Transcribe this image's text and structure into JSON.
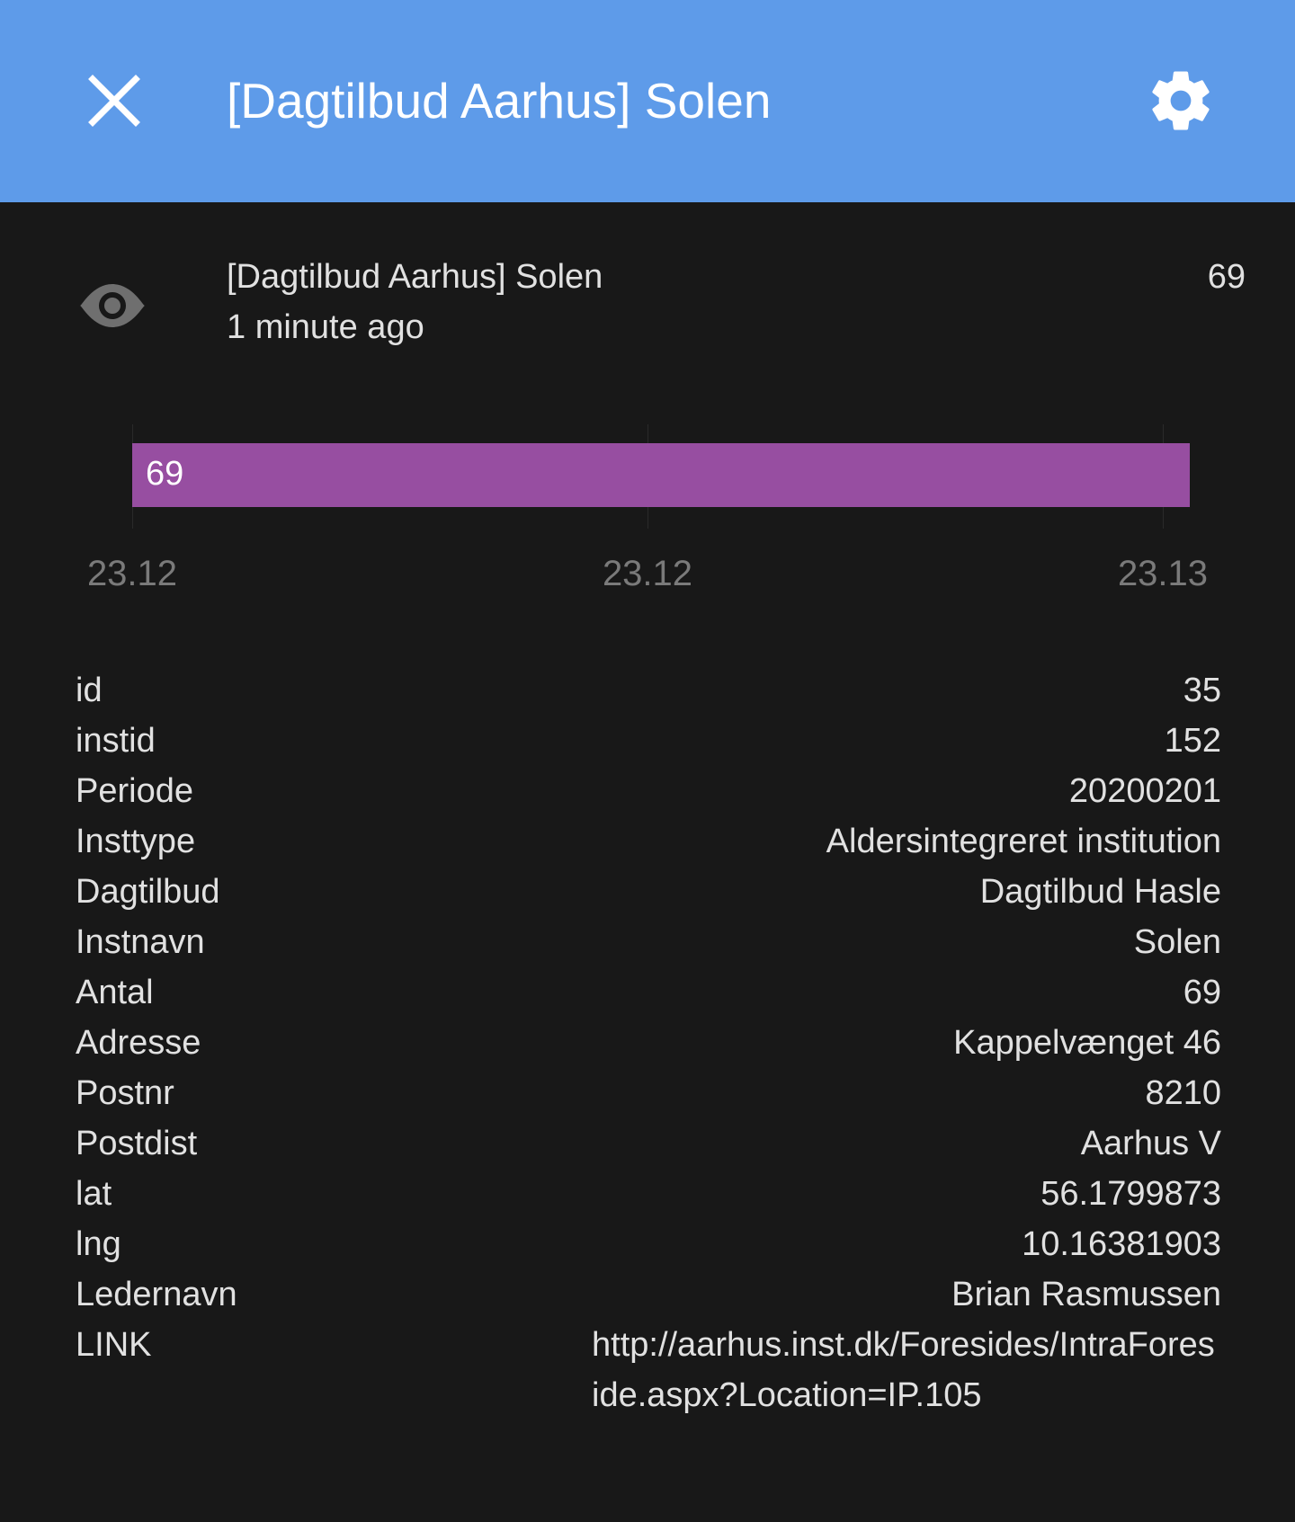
{
  "header": {
    "title": "[Dagtilbud Aarhus] Solen",
    "close_icon": "close-icon",
    "settings_icon": "gear-icon",
    "background_color": "#5e9be9"
  },
  "entity": {
    "icon": "eye-icon",
    "name": "[Dagtilbud Aarhus] Solen",
    "last_changed": "1 minute ago",
    "state": "69"
  },
  "timeline": {
    "bar_label": "69",
    "bar_color": "#974ea1",
    "axis_labels": [
      "23.12",
      "23.12",
      "23.13"
    ]
  },
  "attributes": [
    {
      "key": "id",
      "value": "35"
    },
    {
      "key": "instid",
      "value": "152"
    },
    {
      "key": "Periode",
      "value": "20200201"
    },
    {
      "key": "Insttype",
      "value": "Aldersintegreret institution"
    },
    {
      "key": "Dagtilbud",
      "value": "Dagtilbud Hasle"
    },
    {
      "key": "Instnavn",
      "value": "Solen"
    },
    {
      "key": "Antal",
      "value": "69"
    },
    {
      "key": "Adresse",
      "value": "Kappelvænget 46"
    },
    {
      "key": "Postnr",
      "value": "8210"
    },
    {
      "key": "Postdist",
      "value": "Aarhus V"
    },
    {
      "key": "lat",
      "value": "56.1799873"
    },
    {
      "key": "lng",
      "value": "10.16381903"
    },
    {
      "key": "Ledernavn",
      "value": "Brian Rasmussen"
    },
    {
      "key": "LINK",
      "value": "http://aarhus.inst.dk/Foresides/IntraForeside.aspx?Location=IP.105"
    }
  ]
}
